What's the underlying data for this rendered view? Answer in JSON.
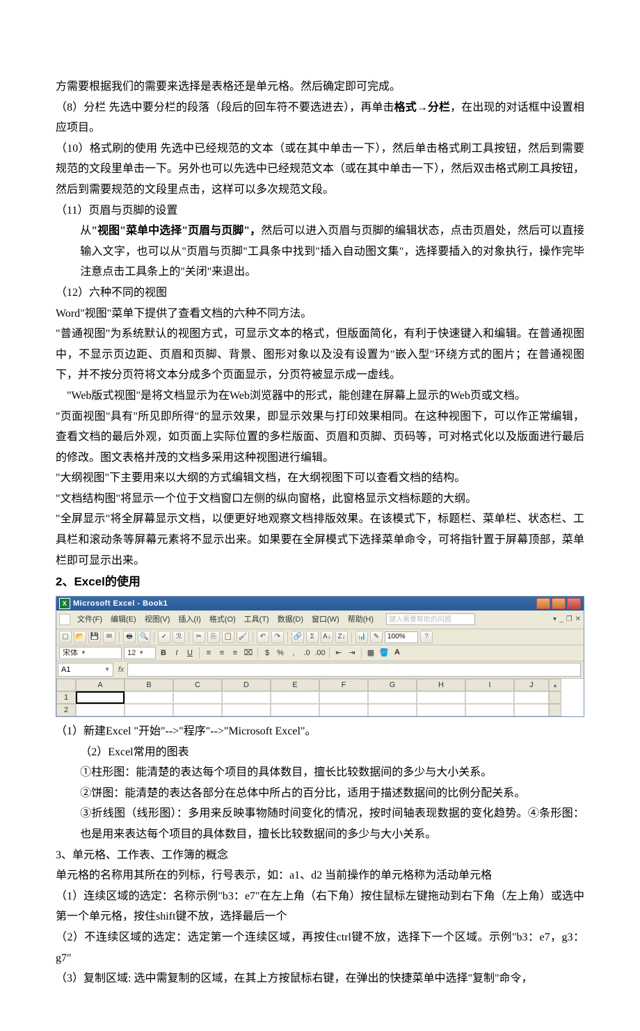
{
  "p_intro": "方需要根据我们的需要来选择是表格还是单元格。然后确定即可完成。",
  "p8_a": "（8）分栏 先选中要分栏的段落（段后的回车符不要选进去），再单击",
  "p8_bold": "格式→分栏",
  "p8_b": "，在出现的对话框中设置相应项目。",
  "p10": "（10）格式刷的使用 先选中已经规范的文本（或在其中单击一下），然后单击格式刷工具按钮，然后到需要规范的文段里单击一下。另外也可以先选中已经规范文本（或在其中单击一下），然后双击格式刷工具按钮，然后到需要规范的文段里点击，这样可以多次规范文段。",
  "p11_t": "（11）页眉与页脚的设置",
  "p11_a": "从",
  "p11_bold": "\"视图\"菜单中选择\"页眉与页脚\"，",
  "p11_b": "然后可以进入页眉与页脚的编辑状态，点击页眉处，然后可以直接输入文字，也可以从\"页眉与页脚\"工具条中找到\"插入自动图文集\"，选择要插入的对象执行，操作完毕注意点击工具条上的\"关闭\"来退出。",
  "p12_t": "（12）六种不同的视图",
  "p12_1": "Word\"视图\"菜单下提供了查看文档的六种不同方法。",
  "p12_2": "\"普通视图\"为系统默认的视图方式，可显示文本的格式，但版面简化，有利于快速键入和编辑。在普通视图中，不显示页边距、页眉和页脚、背景、图形对象以及没有设置为\"嵌入型\"环绕方式的图片；在普通视图下，并不按分页符将文本分成多个页面显示，分页符被显示成一虚线。",
  "p12_3": "\"Web版式视图\"是将文档显示为在Web浏览器中的形式，能创建在屏幕上显示的Web页或文档。",
  "p12_4": "\"页面视图\"具有\"所见即所得\"的显示效果，即显示效果与打印效果相同。在这种视图下，可以作正常编辑，查看文档的最后外观，如页面上实际位置的多栏版面、页眉和页脚、页码等，可对格式化以及版面进行最后的修改。图文表格并茂的文档多采用这种视图进行编辑。",
  "p12_5": "\"大纲视图\"下主要用来以大纲的方式编辑文档，在大纲视图下可以查看文档的结构。",
  "p12_6": "\"文档结构图\"将显示一个位于文档窗口左侧的纵向窗格，此窗格显示文档标题的大纲。",
  "p12_7": "\"全屏显示\"将全屏幕显示文档，以便更好地观察文档排版效果。在该模式下，标题栏、菜单栏、状态栏、工具栏和滚动条等屏幕元素将不显示出来。如果要在全屏模式下选择菜单命令，可将指针置于屏幕顶部，菜单栏即可显示出来。",
  "h2": "2、Excel的使用",
  "excel": {
    "title": "Microsoft Excel - Book1",
    "menus": [
      "文件(F)",
      "编辑(E)",
      "视图(V)",
      "插入(I)",
      "格式(O)",
      "工具(T)",
      "数据(D)",
      "窗口(W)",
      "帮助(H)"
    ],
    "help_ph": "键入需要帮助的问题",
    "zoom": "100%",
    "font": "宋体",
    "size": "12",
    "name": "A1",
    "cols": [
      "A",
      "B",
      "C",
      "D",
      "E",
      "F",
      "G",
      "H",
      "I",
      "J"
    ],
    "rows": [
      "1",
      "2"
    ]
  },
  "s2_1": "（1）新建Excel  \"开始\"-->\"程序\"-->\"Microsoft Excel\"。",
  "s2_2": "（2）Excel常用的图表",
  "s2_2a": "①柱形图：能清楚的表达每个项目的具体数目，擅长比较数据间的多少与大小关系。",
  "s2_2b": "②饼图：能清楚的表达各部分在总体中所占的百分比，适用于描述数据间的比例分配关系。",
  "s2_2c": "③折线图（线形图）：多用来反映事物随时间变化的情况，按时间轴表现数据的变化趋势。④条形图：也是用来表达每个项目的具体数目，擅长比较数据间的多少与大小关系。",
  "h3": "3、单元格、工作表、工作簿的概念",
  "s3_0": "单元格的名称用其所在的列标，行号表示，如：a1、d2 当前操作的单元格称为活动单元格",
  "s3_1": "（1）连续区域的选定：名称示例\"b3：e7\"在左上角（右下角）按住鼠标左键拖动到右下角（左上角）或选中第一个单元格，按住shift键不放，选择最后一个",
  "s3_2": "（2）不连续区域的选定：选定第一个连续区域，再按住ctrl键不放，选择下一个区域。示例\"b3：e7，g3：g7\"",
  "s3_3": "（3）复制区域: 选中需复制的区域，在其上方按鼠标右键，在弹出的快捷菜单中选择\"复制\"命令，"
}
